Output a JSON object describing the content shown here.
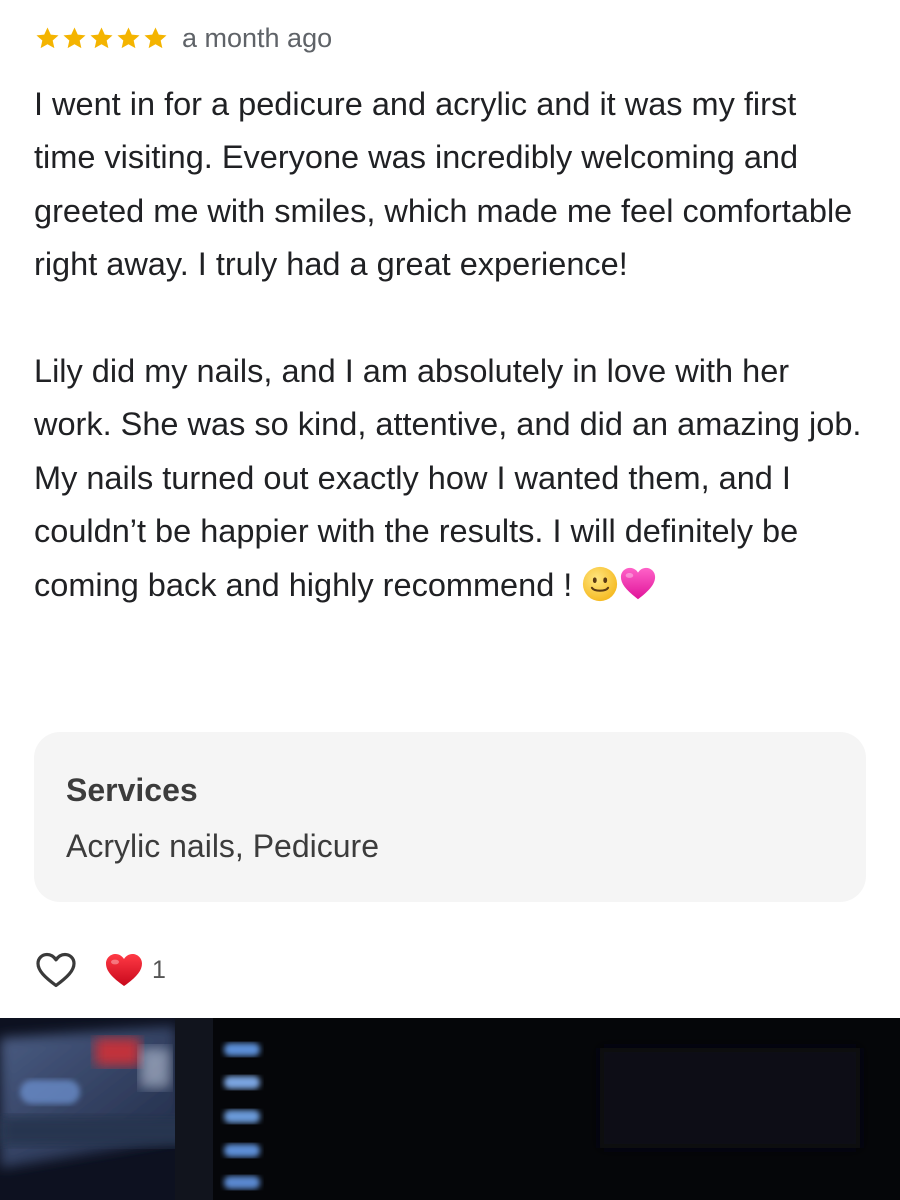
{
  "review": {
    "rating": 5,
    "max_rating": 5,
    "date": "a month ago",
    "paragraphs": [
      "I went in for a pedicure and acrylic and it was my first time visiting. Everyone was incredibly welcoming and greeted me with smiles, which made me feel comfortable right away. I truly had a great experience!",
      "Lily did my nails, and I am absolutely in love with her work. She was so kind, attentive, and did an amazing job. My nails turned out exactly how I wanted them, and I couldn’t be happier with the results. I will definitely be coming back and highly recommend !"
    ],
    "trailing_emoji": [
      "slightly-smiling-face",
      "pink-heart"
    ]
  },
  "services": {
    "title": "Services",
    "value": "Acrylic nails, Pedicure"
  },
  "reactions": {
    "like_icon": "heart-outline-icon",
    "heart_icon": "red-heart-icon",
    "count": "1"
  },
  "colors": {
    "star": "#f4b400",
    "card_background": "#f5f5f5",
    "secondary_text": "#5f6368",
    "heart_red": "#e0102a",
    "heart_pink": "#ff3cb4"
  }
}
